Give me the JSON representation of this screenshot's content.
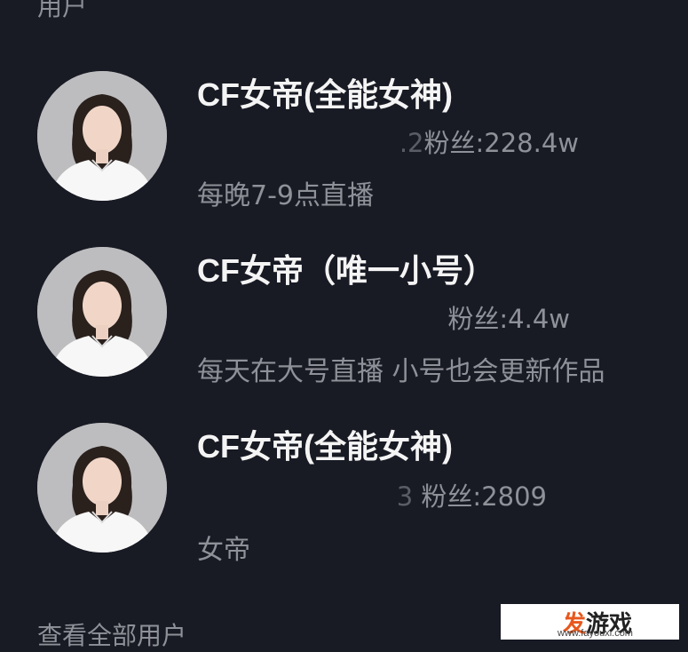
{
  "section": {
    "title": "用户"
  },
  "users": [
    {
      "name": "CF女帝(全能女神)",
      "meta_blur": ".2",
      "fans": "粉丝:228.4w",
      "description": "每晚7-9点直播"
    },
    {
      "name": "CF女帝（唯一小号）",
      "meta_blur": "",
      "fans": "粉丝:4.4w",
      "description": "每天在大号直播 小号也会更新作品"
    },
    {
      "name": "CF女帝(全能女神)",
      "meta_blur": "3",
      "fans": "粉丝:2809",
      "description": "女帝"
    }
  ],
  "footer": {
    "view_all": "查看全部用户"
  },
  "watermark": {
    "logo_part1": "发",
    "logo_part2": "游戏",
    "url": "www.fayouxi.com"
  }
}
